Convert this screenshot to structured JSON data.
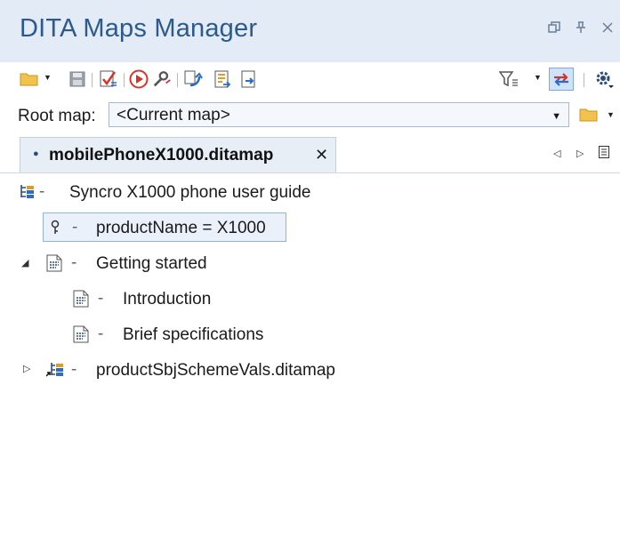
{
  "window": {
    "title": "DITA Maps Manager",
    "controls": [
      "restore",
      "pin",
      "close"
    ]
  },
  "toolbar": {
    "left_buttons": [
      "open-folder",
      "save",
      "validate",
      "run-transformation",
      "configure-transformation",
      "refactor",
      "open-map-in-editor",
      "open-resource"
    ],
    "right_buttons": [
      "filter",
      "link-with-editor",
      "settings"
    ]
  },
  "root_map": {
    "label": "Root map:",
    "value": "<Current map>"
  },
  "tabs": [
    {
      "label": "mobilePhoneX1000.ditamap",
      "modified": true,
      "active": true
    }
  ],
  "tree": [
    {
      "label": "Syncro X1000 phone user guide",
      "icon": "ditamap-root-icon",
      "level": 0
    },
    {
      "label": "productName = X1000",
      "icon": "key-icon",
      "level": 1,
      "selected": true
    },
    {
      "label": "Getting started",
      "icon": "topic-icon",
      "level": 0,
      "expanded": true
    },
    {
      "label": "Introduction",
      "icon": "topic-icon",
      "level": 1
    },
    {
      "label": "Brief specifications",
      "icon": "topic-icon",
      "level": 1
    },
    {
      "label": "productSbjSchemeVals.ditamap",
      "icon": "submap-icon",
      "level": 0,
      "expanded": false
    }
  ],
  "colors": {
    "title_bar_bg": "#e3ebf6",
    "title_text": "#2c5a8c",
    "selection_bg": "#eaf1fb",
    "selection_border": "#8fb2de"
  }
}
